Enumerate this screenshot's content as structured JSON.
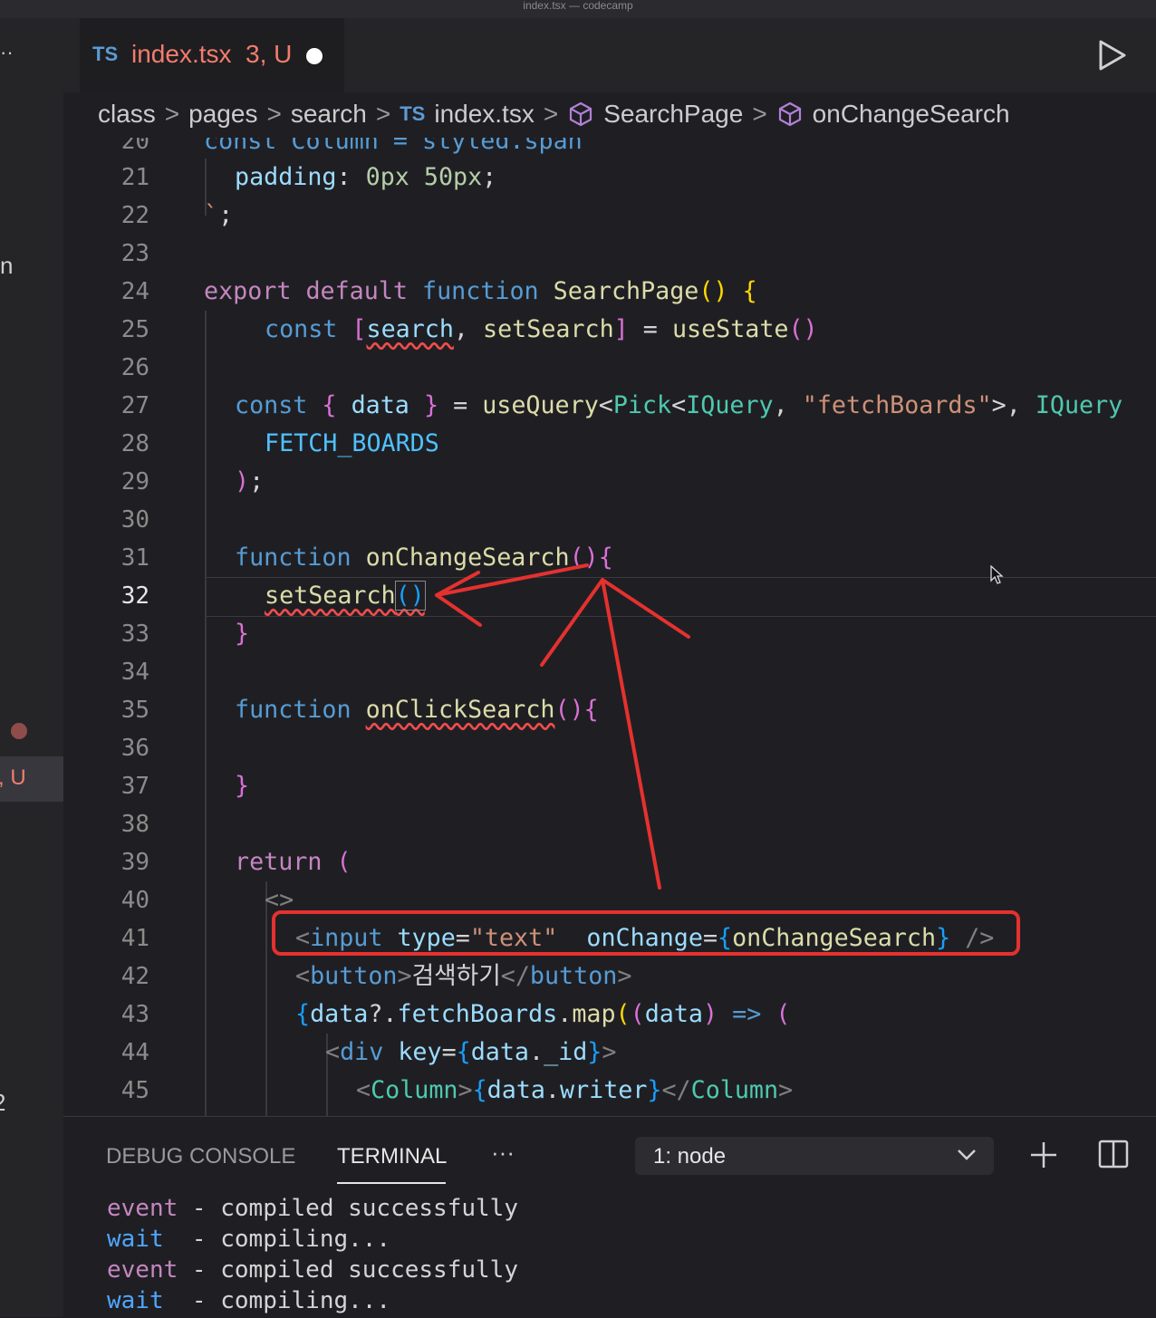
{
  "window": {
    "title": "index.tsx — codecamp"
  },
  "sidebar": {
    "glyph_top": "n",
    "glyph_bottom": "2",
    "active_item_status": ", U"
  },
  "tab": {
    "lang_badge": "TS",
    "filename": "index.tsx",
    "status": "3, U",
    "run_icon": "run-icon"
  },
  "breadcrumb": {
    "items": [
      "class",
      "pages",
      "search",
      "index.tsx",
      "SearchPage",
      "onChangeSearch"
    ],
    "file_badge": "TS"
  },
  "editor": {
    "partial_line": "const Column = styled.span`",
    "line_numbers": [
      "20",
      "21",
      "22",
      "23",
      "24",
      "25",
      "26",
      "27",
      "28",
      "29",
      "30",
      "31",
      "32",
      "33",
      "34",
      "35",
      "36",
      "37",
      "38",
      "39",
      "40",
      "41",
      "42",
      "43",
      "44",
      "45"
    ],
    "current_line": "32",
    "lines": {
      "l21": [
        "padding",
        ": ",
        "0px 50px",
        ";"
      ],
      "l22": [
        "`",
        ";"
      ],
      "l24": [
        "export",
        " ",
        "default",
        " ",
        "function",
        " ",
        "SearchPage",
        "()",
        " ",
        "{"
      ],
      "l25": [
        "const",
        " ",
        "[",
        "search",
        ", ",
        "setSearch",
        "]",
        " = ",
        "useState",
        "()"
      ],
      "l27": [
        "const",
        " ",
        "{",
        " ",
        "data",
        " ",
        "}",
        " = ",
        "useQuery",
        "<",
        "Pick",
        "<",
        "IQuery",
        ", ",
        "\"fetchBoards\"",
        ">, ",
        "IQuery"
      ],
      "l28": [
        "FETCH_BOARDS"
      ],
      "l29": [
        ")",
        ";"
      ],
      "l31": [
        "function",
        " ",
        "onChangeSearch",
        "()",
        "{"
      ],
      "l32": [
        "setSearch",
        "()"
      ],
      "l33": [
        "}"
      ],
      "l35": [
        "function",
        " ",
        "onClickSearch",
        "()",
        "{"
      ],
      "l37": [
        "}"
      ],
      "l39": [
        "return",
        " ",
        "("
      ],
      "l40": [
        "<>"
      ],
      "l41": [
        "<",
        "input",
        " ",
        "type",
        "=",
        "\"text\"",
        "  ",
        "onChange",
        "=",
        "{",
        "onChangeSearch",
        "}",
        " ",
        "/>"
      ],
      "l42": [
        "<",
        "button",
        ">",
        "검색하기",
        "</",
        "button",
        ">"
      ],
      "l43": [
        "{",
        "data",
        "?.",
        "fetchBoards",
        ".",
        "map",
        "(",
        "(",
        "data",
        ")",
        " ",
        "=>",
        " ",
        "("
      ],
      "l44": [
        "<",
        "div",
        " ",
        "key",
        "=",
        "{",
        "data",
        ".",
        "_id",
        "}",
        ">"
      ],
      "l45": [
        "<",
        "Column",
        ">",
        "{",
        "data",
        ".",
        "writer",
        "}",
        "</",
        "Column",
        ">"
      ]
    }
  },
  "panel": {
    "tabs": [
      "DEBUG CONSOLE",
      "TERMINAL"
    ],
    "active_tab": "TERMINAL",
    "more": "···",
    "terminal_select": "1: node",
    "terminal_lines": [
      {
        "tag": "event",
        "sep": " - ",
        "msg": "compiled successfully"
      },
      {
        "tag": "wait",
        "sep": "  - ",
        "msg": "compiling..."
      },
      {
        "tag": "event",
        "sep": " - ",
        "msg": "compiled successfully"
      },
      {
        "tag": "wait",
        "sep": "  - ",
        "msg": "compiling..."
      }
    ]
  },
  "colors": {
    "background": "#1f1f23",
    "annotation_red": "#e5312f",
    "keyword_purple": "#c586c0",
    "keyword_blue": "#569cd6",
    "function_yellow": "#dcdcaa",
    "string_orange": "#ce9178",
    "type_teal": "#4ec9b0",
    "modified_tab_red": "#f47c6d"
  }
}
